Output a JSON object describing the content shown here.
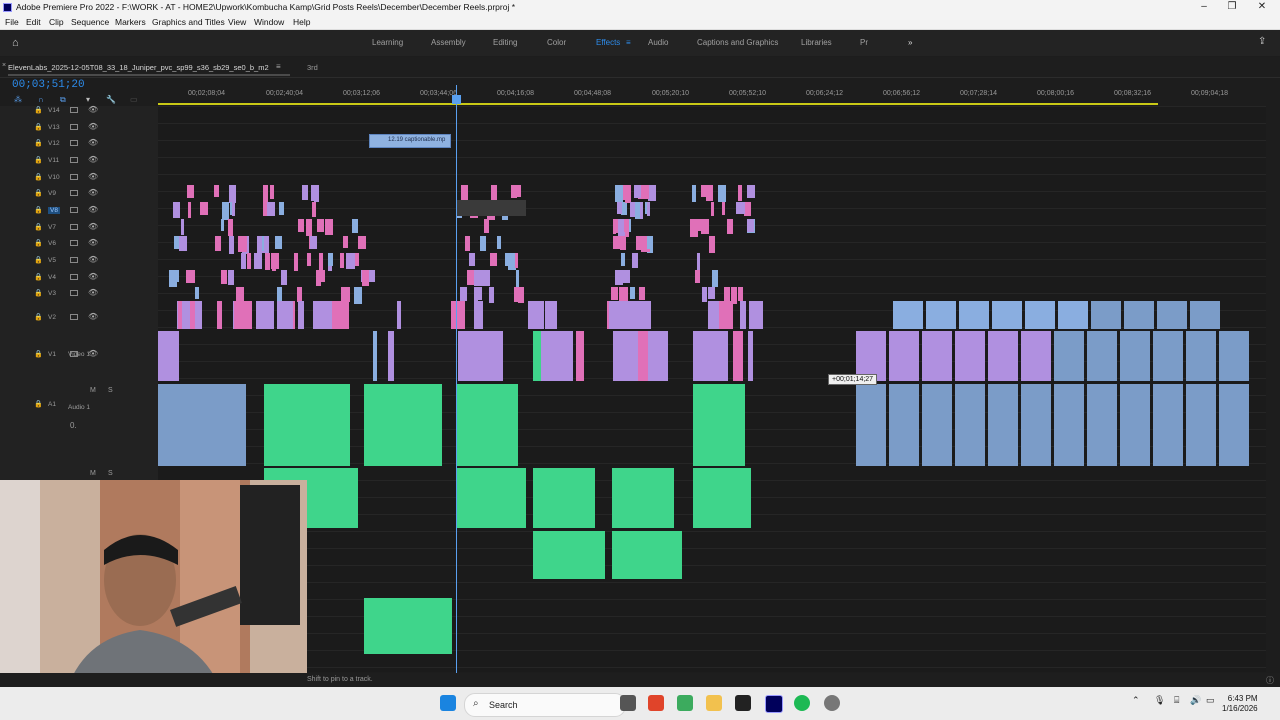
{
  "window": {
    "title": "Adobe Premiere Pro 2022 - F:\\WORK - AT - HOME2\\Upwork\\Kombucha Kamp\\Grid Posts Reels\\December\\December Reels.prproj *"
  },
  "menu": [
    "File",
    "Edit",
    "Clip",
    "Sequence",
    "Markers",
    "Graphics and Titles",
    "View",
    "Window",
    "Help"
  ],
  "workspaces": [
    "Learning",
    "Assembly",
    "Editing",
    "Color",
    "Effects",
    "Audio",
    "Captions and Graphics",
    "Libraries",
    "Pr"
  ],
  "active_workspace": "Effects",
  "sequence_tab": "ElevenLabs_2025-12-05T08_33_18_Juniper_pvc_sp99_s36_sb29_se0_b_m2",
  "second_tab": "3rd",
  "timecode": "00;03;51;20",
  "ruler_ticks": [
    "00;02;08;04",
    "00;02;40;04",
    "00;03;12;06",
    "00;03;44;06",
    "00;04;16;08",
    "00;04;48;08",
    "00;05;20;10",
    "00;05;52;10",
    "00;06;24;12",
    "00;06;56;12",
    "00;07;28;14",
    "00;08;00;16",
    "00;08;32;16",
    "00;09;04;18"
  ],
  "video_tracks": [
    "V14",
    "V13",
    "V12",
    "V11",
    "V10",
    "V9",
    "V8",
    "V7",
    "V6",
    "V5",
    "V4",
    "V3",
    "V2",
    "V1"
  ],
  "v1_name": "Video 1",
  "audio_tracks": [
    "A1"
  ],
  "a1_name": "Audio 1",
  "a1_volume": "0.",
  "m_label": "M",
  "s_label": "S",
  "caption_clip": "12.19 captionable.mp",
  "tooltip": "+00;01;14;27",
  "status_text": "Shift to pin to a track.",
  "taskbar": {
    "search": "Search",
    "time": "6:43 PM",
    "date": "1/16/2026"
  },
  "colors": {
    "accent": "#2d8ceb",
    "video_pink": "#e070b8",
    "video_purple": "#b090e0",
    "audio_green": "#3fd58b",
    "audio_blue": "#7b9cc8"
  }
}
